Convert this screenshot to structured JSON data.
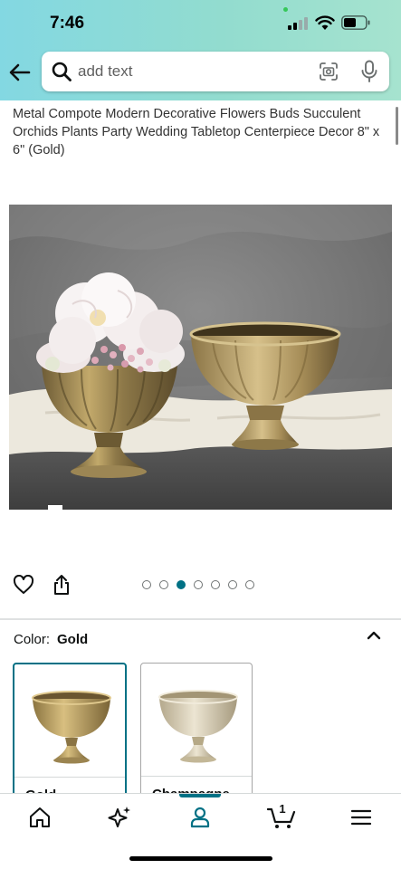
{
  "status_bar": {
    "time": "7:46"
  },
  "search": {
    "placeholder": "add text"
  },
  "product": {
    "title": "Metal Compote Modern Decorative Flowers Buds Succulent Orchids Plants Party Wedding Tabletop Centerpiece Decor 8\" x 6\" (Gold)",
    "image_count": 7,
    "active_image_index": 2
  },
  "variant": {
    "label": "Color:",
    "selected": "Gold",
    "options": [
      {
        "label": "Gold",
        "selected": true
      },
      {
        "label": "Champagne",
        "selected": false
      }
    ]
  },
  "bottom_nav": {
    "items": [
      "home-icon",
      "sparkle-icon",
      "account-icon",
      "cart-icon",
      "menu-icon"
    ],
    "active": "account-icon",
    "cart_count": "1"
  },
  "colors": {
    "accent": "#007185",
    "header_gradient_start": "#83d8e2",
    "header_gradient_end": "#a6e3cf"
  }
}
